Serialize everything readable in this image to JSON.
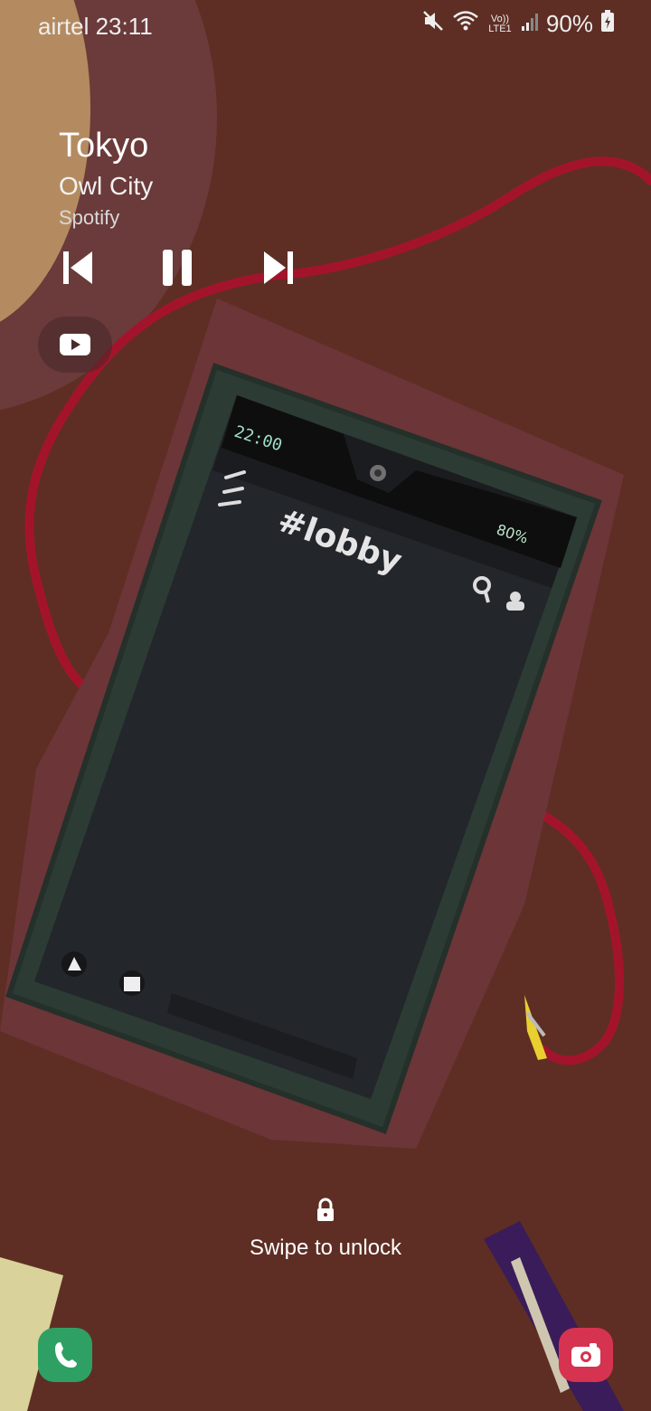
{
  "status_bar": {
    "carrier": "airtel",
    "time": "23:11",
    "network": "Vo)) LTE1",
    "battery": "90%"
  },
  "media": {
    "title": "Tokyo",
    "artist": "Owl City",
    "app": "Spotify"
  },
  "wallpaper_art": {
    "phone_clock": "22:00",
    "phone_channel": "#lobby",
    "phone_battery": "80%"
  },
  "lockscreen": {
    "unlock_hint": "Swipe to unlock"
  },
  "colors": {
    "background": "#5e2e24",
    "accent_phone": "#2fa063",
    "accent_camera": "#d63350"
  }
}
